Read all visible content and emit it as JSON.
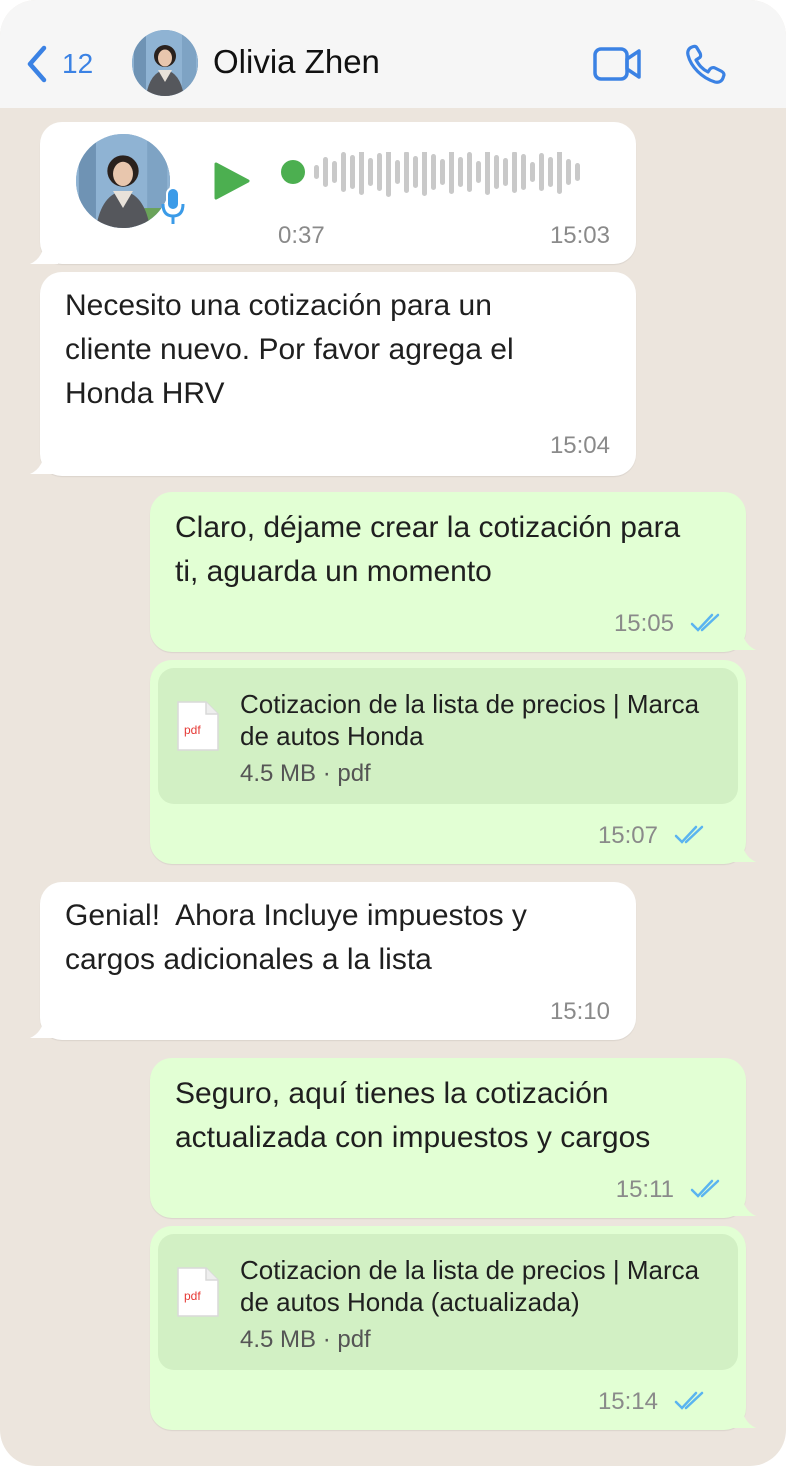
{
  "header": {
    "back_count": "12",
    "contact_name": "Olivia Zhen"
  },
  "icons": {
    "back": "chevron-left-icon",
    "video": "video-camera-icon",
    "call": "phone-icon",
    "play": "play-icon",
    "mic": "microphone-icon",
    "file": "pdf-file-icon",
    "read": "double-check-icon"
  },
  "colors": {
    "accent": "#3b82e4",
    "incoming_bubble": "#ffffff",
    "outgoing_bubble": "#e2ffd4",
    "file_card": "#d2f0c4",
    "play": "#4caf50",
    "read_ticks": "#5ab4f0",
    "chat_background": "#ece5dd"
  },
  "messages": [
    {
      "type": "voice",
      "direction": "incoming",
      "duration": "0:37",
      "time": "15:03"
    },
    {
      "type": "text",
      "direction": "incoming",
      "text": "Necesito una cotización para un\ncliente nuevo. Por favor agrega el\nHonda HRV",
      "time": "15:04"
    },
    {
      "type": "text",
      "direction": "outgoing",
      "text": "Claro, déjame crear la cotización para\nti, aguarda un momento",
      "time": "15:05"
    },
    {
      "type": "file",
      "direction": "outgoing",
      "file_icon_label": "pdf",
      "title": "Cotizacion de la lista de precios | Marca\nde autos Honda",
      "meta": "4.5 MB · pdf",
      "time": "15:07"
    },
    {
      "type": "text",
      "direction": "incoming",
      "text": "Genial!  Ahora Incluye impuestos y\ncargos adicionales a la lista",
      "time": "15:10"
    },
    {
      "type": "text",
      "direction": "outgoing",
      "text": "Seguro, aquí tienes la cotización\nactualizada con impuestos y cargos",
      "time": "15:11"
    },
    {
      "type": "file",
      "direction": "outgoing",
      "file_icon_label": "pdf",
      "title": "Cotizacion de la lista de precios | Marca\nde autos Honda (actualizada)",
      "meta": "4.5 MB · pdf",
      "time": "15:14"
    }
  ]
}
